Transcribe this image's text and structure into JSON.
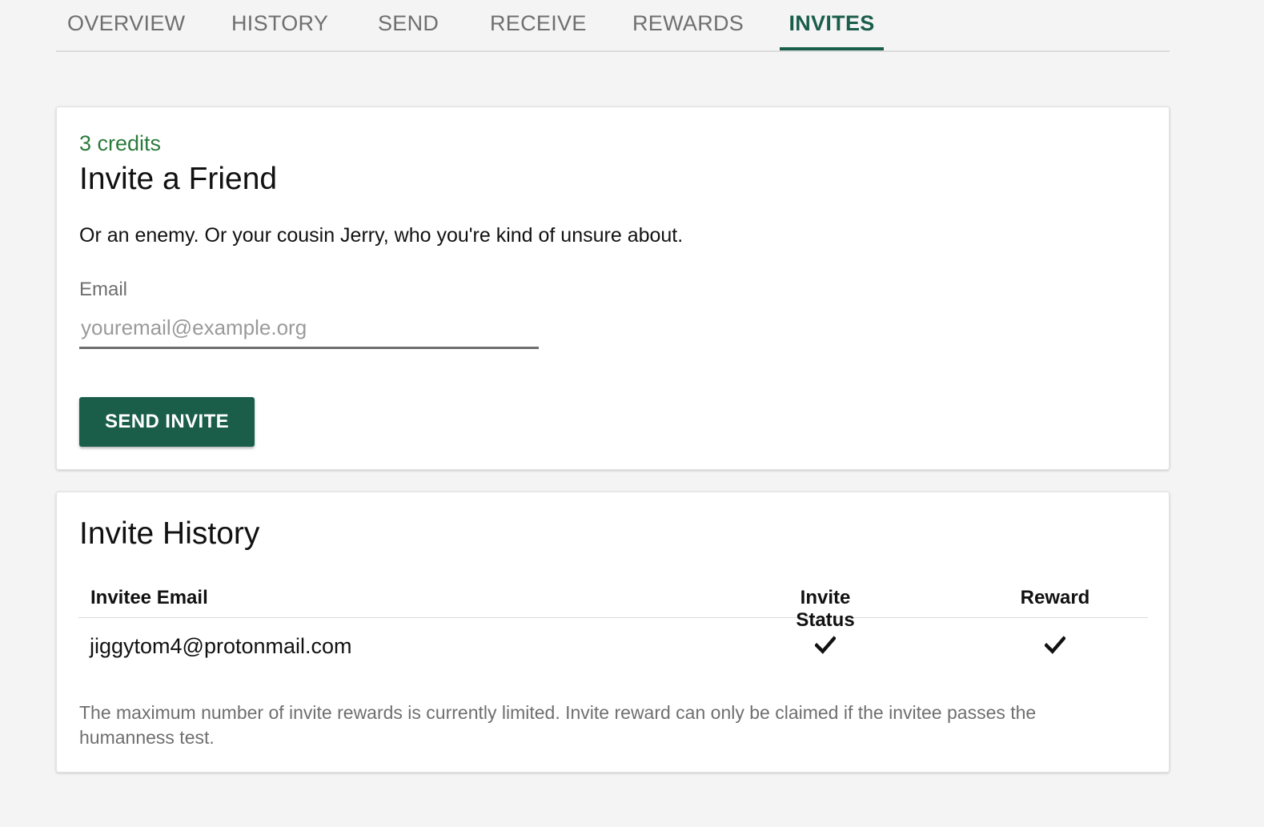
{
  "tabs": [
    {
      "label": "OVERVIEW",
      "active": false
    },
    {
      "label": "HISTORY",
      "active": false
    },
    {
      "label": "SEND",
      "active": false
    },
    {
      "label": "RECEIVE",
      "active": false
    },
    {
      "label": "REWARDS",
      "active": false
    },
    {
      "label": "INVITES",
      "active": true
    }
  ],
  "invite": {
    "credits": "3 credits",
    "title": "Invite a Friend",
    "subtitle": "Or an enemy. Or your cousin Jerry, who you're kind of unsure about.",
    "email_label": "Email",
    "email_value": "",
    "email_placeholder": "youremail@example.org",
    "send_label": "SEND INVITE"
  },
  "history": {
    "title": "Invite History",
    "columns": {
      "email": "Invitee Email",
      "status": "Invite Status",
      "reward": "Reward"
    },
    "rows": [
      {
        "email": "jiggytom4@protonmail.com",
        "status_icon": "check-icon",
        "reward_icon": "check-icon"
      }
    ],
    "note": "The maximum number of invite rewards is currently limited. Invite reward can only be claimed if the invitee passes the humanness test."
  },
  "colors": {
    "accent": "#1a5e4a",
    "credits": "#2b7a3c",
    "muted": "#6f6f6f",
    "background": "#f4f4f4"
  }
}
